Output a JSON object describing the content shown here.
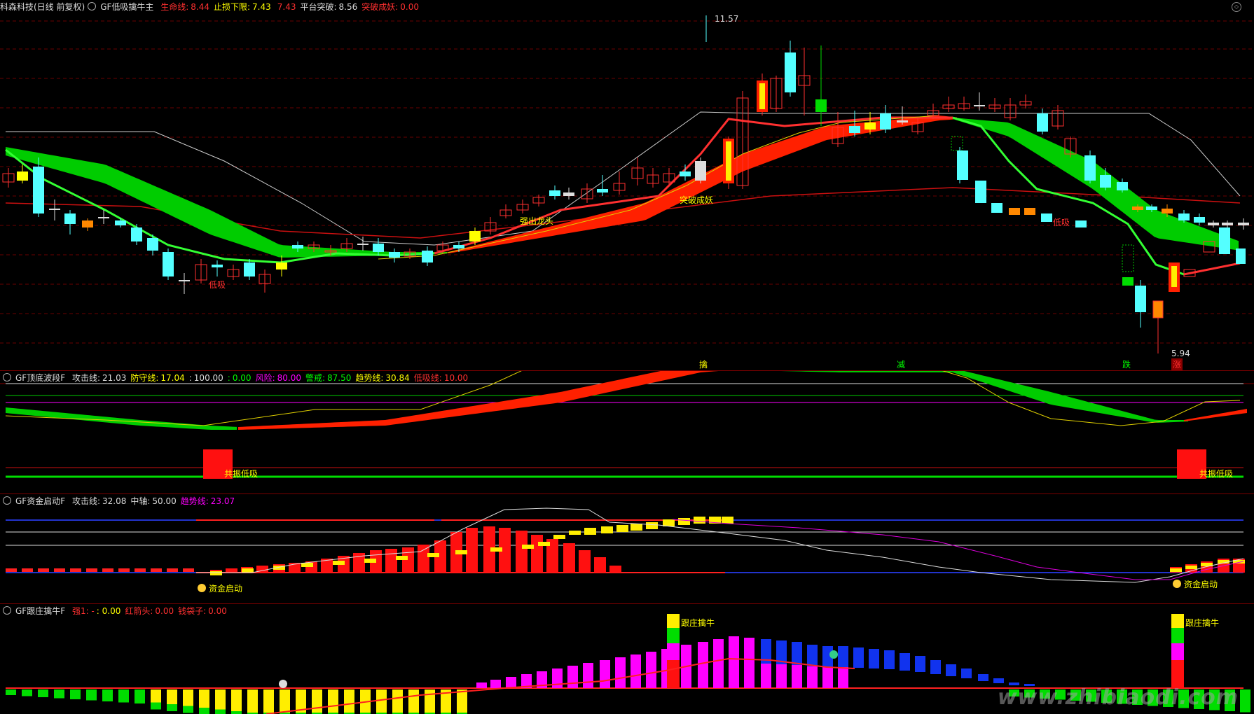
{
  "main": {
    "stock_label": "科森科技(日线 前复权)",
    "indicator_name": "GF低吸擒牛主",
    "readouts": [
      {
        "label": "生命线:",
        "value": "8.44",
        "label_color": "#ff3030",
        "value_color": "#ff3030"
      },
      {
        "label": "止损下限:",
        "value": "7.43",
        "label_color": "#ffff00",
        "value_color": "#ffff00"
      },
      {
        "label": "",
        "value": "7.43",
        "label_color": "#ff3030",
        "value_color": "#ff3030"
      },
      {
        "label": "平台突破:",
        "value": "8.56",
        "label_color": "#dddddd",
        "value_color": "#dddddd"
      },
      {
        "label": "突破成妖:",
        "value": "0.00",
        "label_color": "#ff3030",
        "value_color": "#ff3030"
      }
    ],
    "high_label": "11.57",
    "low_label": "5.94",
    "annotations": [
      {
        "text": "低吸",
        "color": "#ff3030"
      },
      {
        "text": "强出龙头",
        "color": "#ffff00"
      },
      {
        "text": "突破成妖",
        "color": "#ffff00"
      },
      {
        "text": "低吸",
        "color": "#ff3030"
      }
    ],
    "bottom_markers": [
      {
        "text": "擒",
        "color": "#ffff00"
      },
      {
        "text": "减",
        "color": "#00ff00"
      },
      {
        "text": "跌",
        "color": "#00ff00"
      },
      {
        "text": "涨",
        "color": "#ff3030"
      }
    ]
  },
  "panel2": {
    "indicator_name": "GF顶底波段F",
    "readouts": [
      {
        "label": "攻击线:",
        "value": "21.03",
        "label_color": "#dddddd",
        "value_color": "#dddddd"
      },
      {
        "label": "防守线:",
        "value": "17.04",
        "label_color": "#ffff00",
        "value_color": "#ffff00"
      },
      {
        "label": ":",
        "value": "100.00",
        "label_color": "#dddddd",
        "value_color": "#dddddd"
      },
      {
        "label": ":",
        "value": "0.00",
        "label_color": "#00ff00",
        "value_color": "#00ff00"
      },
      {
        "label": "风险:",
        "value": "80.00",
        "label_color": "#ff00ff",
        "value_color": "#ff00ff"
      },
      {
        "label": "警戒:",
        "value": "87.50",
        "label_color": "#00ff00",
        "value_color": "#00ff00"
      },
      {
        "label": "趋势线:",
        "value": "30.84",
        "label_color": "#ffff00",
        "value_color": "#ffff00"
      },
      {
        "label": "低吸线:",
        "value": "10.00",
        "label_color": "#ff3030",
        "value_color": "#ff3030"
      }
    ],
    "signal_label": "共振低吸"
  },
  "panel3": {
    "indicator_name": "GF资金启动F",
    "readouts": [
      {
        "label": "攻击线:",
        "value": "32.08",
        "label_color": "#dddddd",
        "value_color": "#dddddd"
      },
      {
        "label": "中轴:",
        "value": "50.00",
        "label_color": "#dddddd",
        "value_color": "#dddddd"
      },
      {
        "label": "趋势线:",
        "value": "23.07",
        "label_color": "#ff00ff",
        "value_color": "#ff00ff"
      }
    ],
    "signal_label": "资金启动"
  },
  "panel4": {
    "indicator_name": "GF跟庄擒牛F",
    "readouts": [
      {
        "label": "强1: -",
        "value": ": 0.00",
        "label_color": "#ff3030",
        "value_color": "#ffff00"
      },
      {
        "label": "红箭头:",
        "value": "0.00",
        "label_color": "#ff3030",
        "value_color": "#ff3030"
      },
      {
        "label": "钱袋子:",
        "value": "0.00",
        "label_color": "#ff3030",
        "value_color": "#ff3030"
      }
    ],
    "signal_label": "跟庄擒牛"
  },
  "watermark": "www.zhibiaodi.com",
  "colors": {
    "up": "#ff3030",
    "down": "#54ffff",
    "band_green": "#00cc00",
    "band_red": "#ff2000",
    "grid": "#7a0000"
  }
}
